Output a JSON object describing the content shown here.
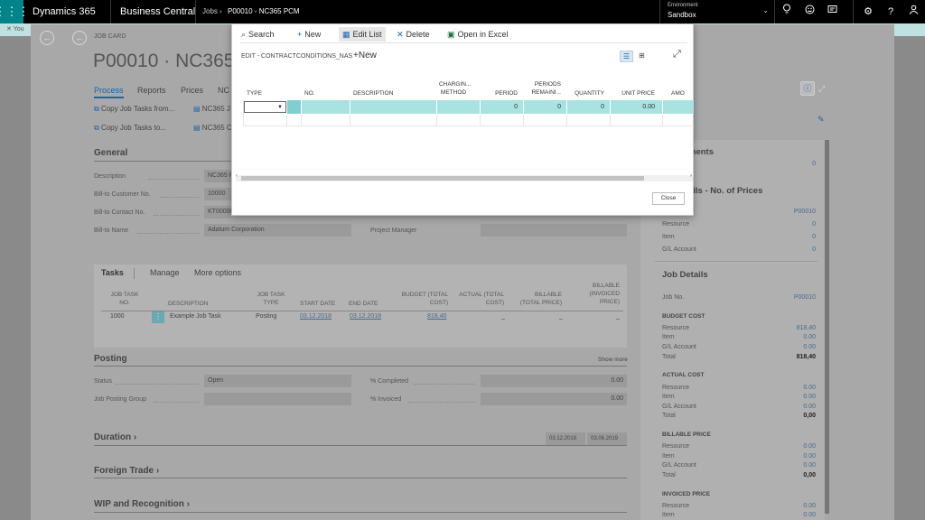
{
  "topbar": {
    "app": "Dynamics 365",
    "product": "Business Central",
    "crumb_root": "Jobs",
    "crumb_sep": "›",
    "crumb_current": "P00010 - NC365 PCM",
    "env_label": "Environment",
    "env_value": "Sandbox"
  },
  "notification": "You",
  "page": {
    "card_label": "JOB CARD",
    "title": "P00010 · NC365 F",
    "tabs": [
      "Process",
      "Reports",
      "Prices",
      "NC"
    ],
    "actions": [
      "Copy Job Tasks from...",
      "Copy Job Tasks to...",
      "NC365 J",
      "NC365 C"
    ]
  },
  "general": {
    "heading": "General",
    "fields": [
      {
        "label": "Description",
        "value": "NC365 F"
      },
      {
        "label": "Bill-to Customer No.",
        "value": "10000"
      },
      {
        "label": "Bill-to Contact No.",
        "value": "KT00000"
      },
      {
        "label": "Bill-to Name",
        "value": "Adatum Corporation"
      }
    ],
    "pm_label": "Project Manager"
  },
  "tasks": {
    "tabs": [
      "Tasks",
      "Manage",
      "More options"
    ],
    "columns": [
      "JOB TASK NO.",
      "DESCRIPTION",
      "JOB TASK TYPE",
      "START DATE",
      "END DATE",
      "BUDGET (TOTAL COST)",
      "ACTUAL (TOTAL COST)",
      "BILLABLE (TOTAL PRICE)",
      "BILLABLE (INVOICED PRICE)"
    ],
    "row": {
      "no": "1000",
      "description": "Example Job Task",
      "type": "Posting",
      "start": "03.12.2018",
      "end": "03.12.2018",
      "budget": "818,40",
      "actual": "_",
      "billable": "_",
      "invoiced": "_"
    }
  },
  "posting": {
    "heading": "Posting",
    "show_more": "Show more",
    "status_label": "Status",
    "status_value": "Open",
    "jpg_label": "Job Posting Group",
    "completed_label": "% Completed",
    "completed_value": "0.00",
    "invoiced_label": "% Invoiced",
    "invoiced_value": "0.00"
  },
  "duration": {
    "heading": "Duration",
    "chev": "›",
    "start": "03.12.2018",
    "end": "03.06.2019"
  },
  "foreign_trade": {
    "heading": "Foreign Trade",
    "chev": "›"
  },
  "wip": {
    "heading": "WIP and Recognition",
    "chev": "›"
  },
  "factbox": {
    "attachments_heading": "ments",
    "attachments_value": "0",
    "prices_heading": "ails - No. of Prices",
    "prices_job": "P00010",
    "prices_rows": [
      {
        "label": "Resource",
        "value": "0"
      },
      {
        "label": "Item",
        "value": "0"
      },
      {
        "label": "G/L Account",
        "value": "0"
      }
    ],
    "job_details_heading": "Job Details",
    "job_no_label": "Job No.",
    "job_no_value": "P00010",
    "sections": [
      {
        "title": "BUDGET COST",
        "rows": [
          {
            "label": "Resource",
            "value": "818,40"
          },
          {
            "label": "Item",
            "value": "0.00"
          },
          {
            "label": "G/L Account",
            "value": "0.00"
          },
          {
            "label": "Total",
            "value": "818,40"
          }
        ]
      },
      {
        "title": "ACTUAL COST",
        "rows": [
          {
            "label": "Resource",
            "value": "0.00"
          },
          {
            "label": "Item",
            "value": "0.00"
          },
          {
            "label": "G/L Account",
            "value": "0.00"
          },
          {
            "label": "Total",
            "value": "0,00"
          }
        ]
      },
      {
        "title": "BILLABLE PRICE",
        "rows": [
          {
            "label": "Resource",
            "value": "0.00"
          },
          {
            "label": "Item",
            "value": "0.00"
          },
          {
            "label": "G/L Account",
            "value": "0.00"
          },
          {
            "label": "Total",
            "value": "0,00"
          }
        ]
      },
      {
        "title": "INVOICED PRICE",
        "rows": [
          {
            "label": "Resource",
            "value": "0.00"
          },
          {
            "label": "Item",
            "value": "0.00"
          }
        ]
      }
    ]
  },
  "dialog": {
    "toolbar": {
      "search": "Search",
      "new": "New",
      "edit_list": "Edit List",
      "delete": "Delete",
      "excel": "Open in Excel"
    },
    "title": "EDIT - CONTRACTCONDITIONS_NAS",
    "new_label": "New",
    "columns": [
      "TYPE",
      "NO.",
      "DESCRIPTION",
      "CHARGIN... METHOD",
      "PERIOD",
      "PERIODS REMAINI...",
      "QUANTITY",
      "UNIT PRICE",
      "AMO"
    ],
    "row": {
      "type": "",
      "period": "0",
      "periods_remaining": "0",
      "quantity": "0",
      "unit_price": "0.00"
    },
    "close": "Close"
  }
}
